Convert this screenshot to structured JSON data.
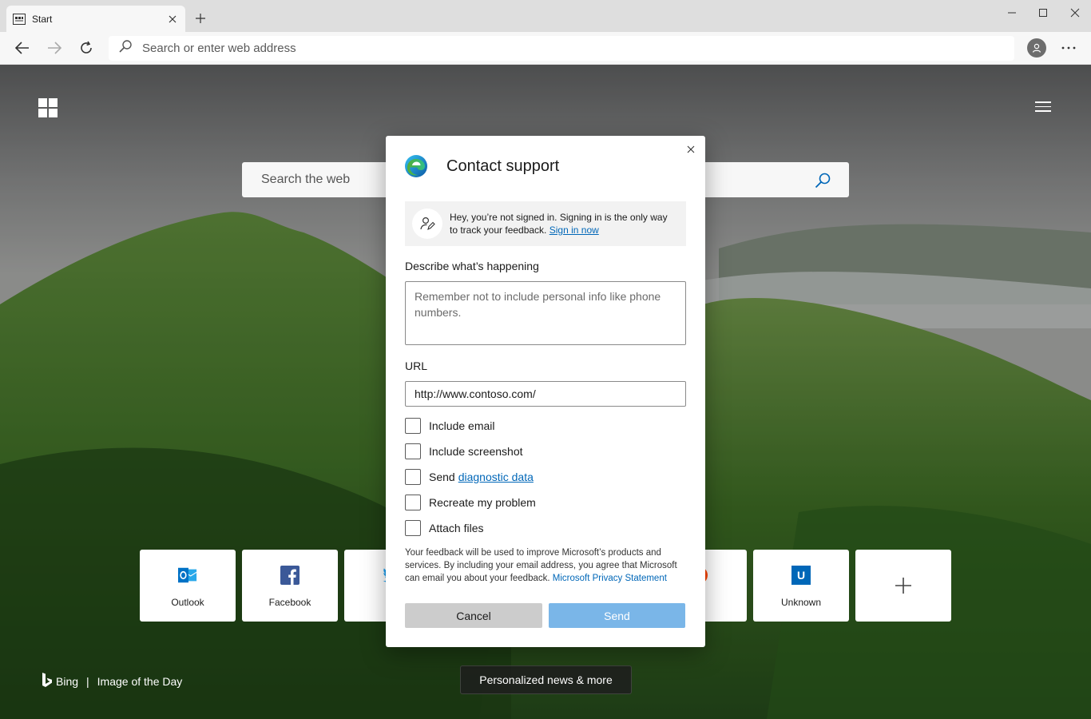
{
  "browser": {
    "tab_title": "Start",
    "address_placeholder": "Search or enter web address"
  },
  "ntp": {
    "search_placeholder": "Search the web",
    "tiles": [
      {
        "label": "Outlook",
        "icon": "outlook-icon",
        "color": "#0072c6"
      },
      {
        "label": "Facebook",
        "icon": "facebook-icon",
        "color": "#3b5998"
      },
      {
        "label": "Tw",
        "icon": "twitter-icon",
        "color": "#1da1f2"
      },
      {
        "label": "dit",
        "icon": "reddit-icon",
        "color": "#ff4500"
      },
      {
        "label": "Unknown",
        "icon": "unknown-site-icon",
        "color": "#0067b8",
        "letter": "U"
      }
    ],
    "bing_label": "Bing",
    "bing_sep": "|",
    "image_of_day": "Image of the Day",
    "news_button": "Personalized news & more"
  },
  "dialog": {
    "title": "Contact support",
    "signin_text": "Hey, you’re not signed in. Signing in is the only way to track your feedback.",
    "signin_link": "Sign in now",
    "describe_label": "Describe what’s happening",
    "describe_placeholder": "Remember not to include personal info like phone numbers.",
    "url_label": "URL",
    "url_value": "http://www.contoso.com/",
    "checkboxes": {
      "include_email": "Include email",
      "include_screenshot": "Include screenshot",
      "send_prefix": "Send",
      "send_link": "diagnostic data",
      "recreate": "Recreate my problem",
      "attach": "Attach files"
    },
    "legal_text": "Your feedback will be used to improve Microsoft’s products and services. By including your email address, you agree that Microsoft can email you about your feedback.",
    "privacy_link": "Microsoft Privacy Statement",
    "cancel_label": "Cancel",
    "send_label": "Send"
  },
  "colors": {
    "accent": "#0067b8",
    "send_disabled": "#7ab6e8",
    "cancel_bg": "#cccccc"
  }
}
